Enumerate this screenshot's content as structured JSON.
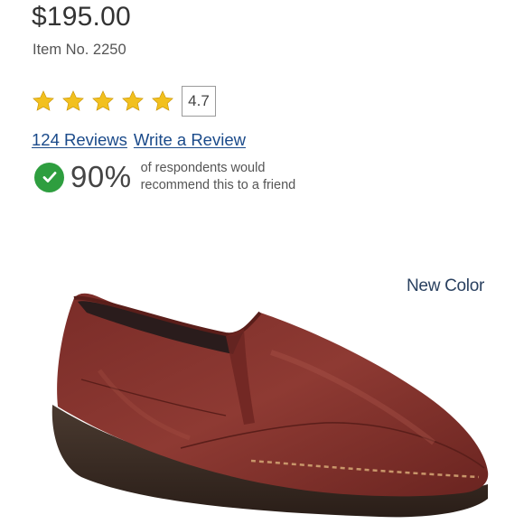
{
  "product": {
    "price": "$195.00",
    "item_no": "Item No. 2250"
  },
  "rating": {
    "value": "4.7",
    "stars_filled": 5,
    "star_color": "#f2c01e"
  },
  "links": {
    "reviews": "124 Reviews",
    "write_review": "Write a Review"
  },
  "recommendation": {
    "percent": "90%",
    "text_line1": "of respondents would",
    "text_line2": "recommend this to a friend",
    "check_color": "#2e9e3f"
  },
  "image": {
    "badge": "New Color",
    "description_icon": "shoe-image"
  }
}
